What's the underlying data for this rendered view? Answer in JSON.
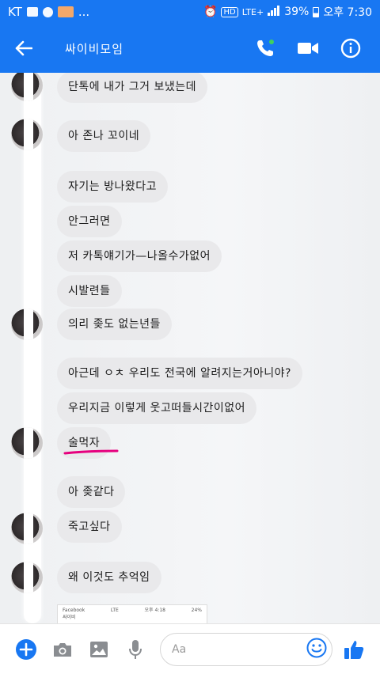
{
  "status_bar": {
    "carrier": "KT",
    "ellipsis": "...",
    "network": "LTE+",
    "battery": "39%",
    "time": "오후 7:30"
  },
  "header": {
    "title": "싸이비모임"
  },
  "messages": [
    {
      "text": "단톡에 내가 그거 보냈는데"
    },
    {
      "text": "아 존나 꼬이네"
    },
    {
      "text": "자기는 방나왔다고"
    },
    {
      "text": "안그러면"
    },
    {
      "text": "저 카톡얘기가—나올수가없어"
    },
    {
      "text": "시발련들"
    },
    {
      "text": "의리 좆도 없는년들"
    },
    {
      "text": "아근데 ㅇㅊ 우리도 전국에 알려지는거아니야?"
    },
    {
      "text": "우리지금 이렇게 웃고떠들시간이없어"
    },
    {
      "text": "술먹자"
    },
    {
      "text": "아 좆같다"
    },
    {
      "text": "죽고싶다"
    },
    {
      "text": "왜 이것도 추억임"
    }
  ],
  "preview": {
    "line1_left": "Facebook",
    "line1_mid": "LTE",
    "line1_time": "오후 4:18",
    "line1_battery": "24%",
    "line2": "싸이비"
  },
  "composer": {
    "placeholder": "Aa"
  },
  "colors": {
    "brand": "#1877f2",
    "bubble": "#e9e9eb",
    "underline": "#e6007e"
  }
}
